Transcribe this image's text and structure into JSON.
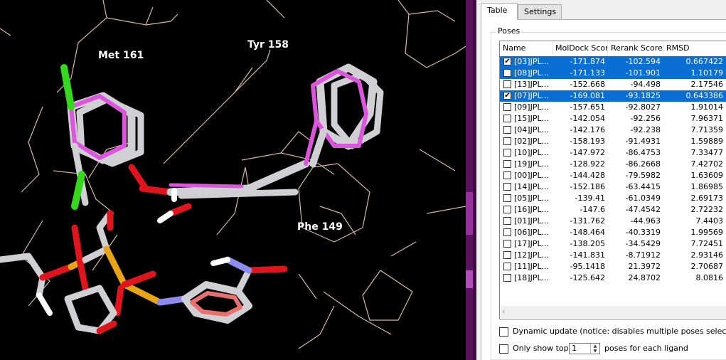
{
  "viewer": {
    "labels": {
      "met161": "Met 161",
      "tyr158": "Tyr 158",
      "phe149": "Phe 149"
    },
    "colors": {
      "background": "#000000",
      "ligand_stick": "#cfcfd4",
      "pose_magenta": "#dd55dd",
      "oxygen": "#e0141c",
      "chlorine": "#33d91a",
      "phosphorus": "#e8a317",
      "nitrogen": "#8c8cf0",
      "aromatic_ring": "#e8706e",
      "protein_lines": "#d9b8a0"
    }
  },
  "panel": {
    "tabs": [
      "Table",
      "Settings"
    ],
    "active_tab": "Table",
    "group_title": "Poses",
    "columns": {
      "name": "Name",
      "moldock": "MolDock Score",
      "rerank": "Rerank Score",
      "rmsd": "RMSD"
    },
    "rows": [
      {
        "name": "[03]JPL...",
        "moldock": "-171.874",
        "rerank": "-102.594",
        "rmsd": "0.667422",
        "checked": true,
        "selected": true
      },
      {
        "name": "[08]JPL...",
        "moldock": "-171.133",
        "rerank": "-101.901",
        "rmsd": "1.10179",
        "checked": false,
        "selected": true
      },
      {
        "name": "[13]JPL...",
        "moldock": "-152.668",
        "rerank": "-94.498",
        "rmsd": "2.17546",
        "checked": false,
        "selected": false
      },
      {
        "name": "[07]JPL...",
        "moldock": "-169.081",
        "rerank": "-93.1825",
        "rmsd": "0.643386",
        "checked": true,
        "selected": true
      },
      {
        "name": "[09]JPL...",
        "moldock": "-157.651",
        "rerank": "-92.8027",
        "rmsd": "1.91014",
        "checked": false,
        "selected": false
      },
      {
        "name": "[15]JPL...",
        "moldock": "-142.054",
        "rerank": "-92.256",
        "rmsd": "7.96371",
        "checked": false,
        "selected": false
      },
      {
        "name": "[04]JPL...",
        "moldock": "-142.176",
        "rerank": "-92.238",
        "rmsd": "7.71359",
        "checked": false,
        "selected": false
      },
      {
        "name": "[02]JPL...",
        "moldock": "-158.193",
        "rerank": "-91.4931",
        "rmsd": "1.59889",
        "checked": false,
        "selected": false
      },
      {
        "name": "[10]JPL...",
        "moldock": "-147.972",
        "rerank": "-86.4753",
        "rmsd": "7.33477",
        "checked": false,
        "selected": false
      },
      {
        "name": "[19]JPL...",
        "moldock": "-128.922",
        "rerank": "-86.2668",
        "rmsd": "7.42702",
        "checked": false,
        "selected": false
      },
      {
        "name": "[00]JPL...",
        "moldock": "-144.428",
        "rerank": "-79.5982",
        "rmsd": "1.63609",
        "checked": false,
        "selected": false
      },
      {
        "name": "[14]JPL...",
        "moldock": "-152.186",
        "rerank": "-63.4415",
        "rmsd": "1.86985",
        "checked": false,
        "selected": false
      },
      {
        "name": "[05]JPL...",
        "moldock": "-139.41",
        "rerank": "-61.0349",
        "rmsd": "2.69173",
        "checked": false,
        "selected": false
      },
      {
        "name": "[16]JPL...",
        "moldock": "-147.6",
        "rerank": "-47.4542",
        "rmsd": "2.72232",
        "checked": false,
        "selected": false
      },
      {
        "name": "[01]JPL...",
        "moldock": "-131.762",
        "rerank": "-44.963",
        "rmsd": "7.4403",
        "checked": false,
        "selected": false
      },
      {
        "name": "[06]JPL...",
        "moldock": "-148.464",
        "rerank": "-40.3319",
        "rmsd": "1.99569",
        "checked": false,
        "selected": false
      },
      {
        "name": "[17]JPL...",
        "moldock": "-138.205",
        "rerank": "-34.5429",
        "rmsd": "7.72451",
        "checked": false,
        "selected": false
      },
      {
        "name": "[12]JPL...",
        "moldock": "-141.831",
        "rerank": "-8.71912",
        "rmsd": "2.93146",
        "checked": false,
        "selected": false
      },
      {
        "name": "[11]JPL...",
        "moldock": "-95.1418",
        "rerank": "21.3972",
        "rmsd": "2.70687",
        "checked": false,
        "selected": false
      },
      {
        "name": "[18]JPL...",
        "moldock": "-125.642",
        "rerank": "24.8702",
        "rmsd": "8.0816",
        "checked": false,
        "selected": false
      }
    ],
    "dynamic_update_label": "Dynamic update (notice: disables multiple poses selection)",
    "dynamic_update_checked": false,
    "only_show_top_label": "Only show top",
    "only_show_top_checked": false,
    "top_count": "1",
    "poses_suffix": "poses for each ligand",
    "selection_color": "#0a6fd2"
  }
}
